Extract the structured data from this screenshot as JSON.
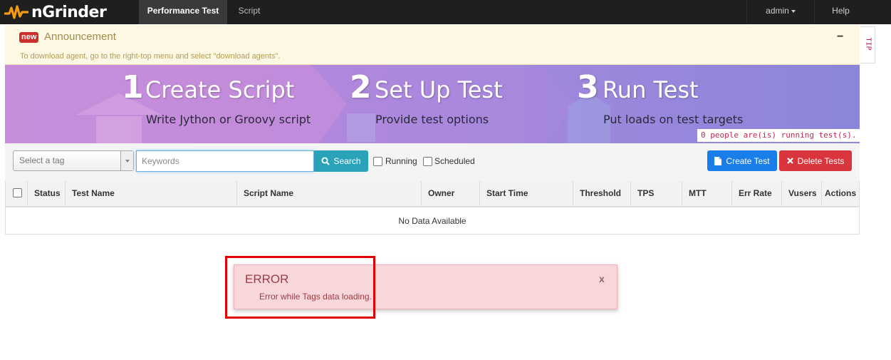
{
  "navbar": {
    "brand": "nGrinder",
    "tabs": [
      {
        "label": "Performance Test",
        "active": true
      },
      {
        "label": "Script",
        "active": false
      }
    ],
    "user": "admin",
    "help": "Help",
    "logo_icon": "pulse-wave-icon",
    "colors": {
      "logo": "#f39c12",
      "bar": "#1f1f1f"
    }
  },
  "announcement": {
    "badge": "new",
    "title": "Announcement",
    "text": "To download agent, go to the right-top menu and select \"download agents\".",
    "collapse": "−",
    "tip": "TIP"
  },
  "banner": {
    "steps": [
      {
        "num": "1",
        "title": "Create Script",
        "subtitle": "Write Jython or Groovy script"
      },
      {
        "num": "2",
        "title": "Set Up Test",
        "subtitle": "Provide test options"
      },
      {
        "num": "3",
        "title": "Run Test",
        "subtitle": "Put loads on test targets"
      }
    ],
    "running_note": "0 people are(is) running test(s)."
  },
  "toolbar": {
    "tag_placeholder": "Select a tag",
    "keywords_placeholder": "Keywords",
    "search": "Search",
    "running": "Running",
    "scheduled": "Scheduled",
    "create": "Create Test",
    "delete": "Delete Tests",
    "colors": {
      "search": "#2aa3b8",
      "create": "#1a7ee8",
      "delete": "#d9353d"
    }
  },
  "table": {
    "columns": [
      "Status",
      "Test Name",
      "Script Name",
      "Owner",
      "Start Time",
      "Threshold",
      "TPS",
      "MTT",
      "Err Rate",
      "Vusers",
      "Actions"
    ],
    "empty": "No Data Available"
  },
  "toast": {
    "title": "ERROR",
    "message": "Error while Tags data loading.",
    "close": "x",
    "colors": {
      "background": "#f8d7da",
      "text": "#9c3c45",
      "highlight": "#e00000"
    }
  }
}
